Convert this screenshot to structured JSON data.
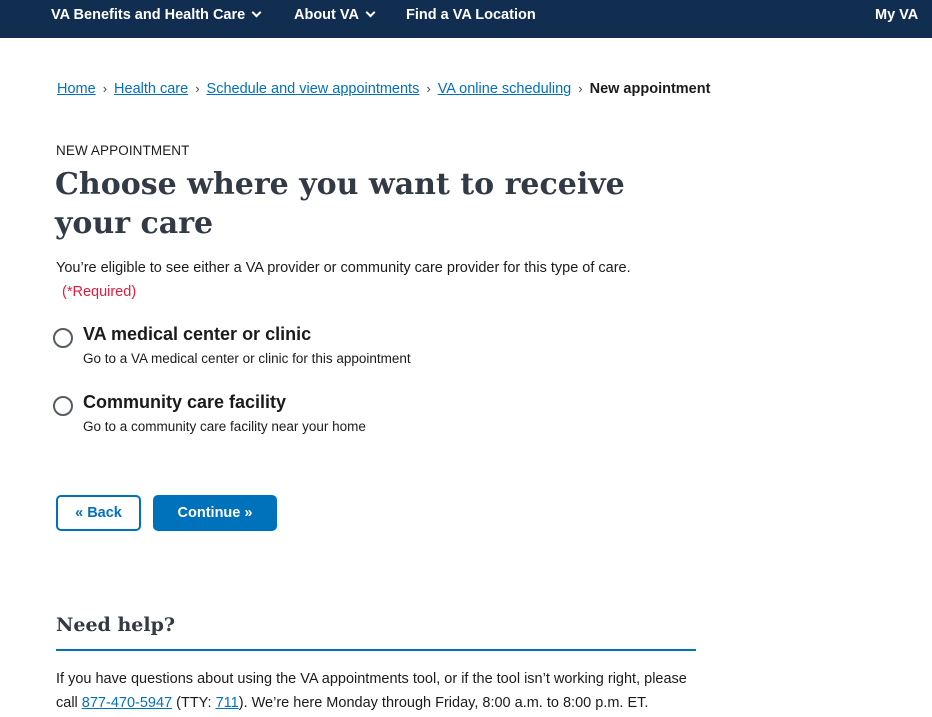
{
  "topnav": {
    "items": [
      {
        "label": "VA Benefits and Health Care",
        "has_dropdown": true
      },
      {
        "label": "About VA",
        "has_dropdown": true
      },
      {
        "label": "Find a VA Location",
        "has_dropdown": false
      }
    ],
    "my_va": "My VA",
    "bg_color": "#112e51"
  },
  "breadcrumb": {
    "items": [
      "Home",
      "Health care",
      "Schedule and view appointments",
      "VA online scheduling"
    ],
    "separator": "›",
    "current": "New appointment"
  },
  "page": {
    "eyebrow": "NEW APPOINTMENT",
    "title": "Choose where you want to receive your care",
    "intro": "You’re eligible to see either a VA provider or community care provider for this type of care.",
    "required": "(*Required)"
  },
  "options": [
    {
      "label": "VA medical center or clinic",
      "description": "Go to a VA medical center or clinic for this appointment",
      "selected": false
    },
    {
      "label": "Community care facility",
      "description": "Go to a community care facility near your home",
      "selected": false
    }
  ],
  "buttons": {
    "back": "« Back",
    "continue": "Continue »"
  },
  "help": {
    "title": "Need help?",
    "text_1": "If you have questions about using the VA appointments tool, or if the tool isn’t working right, please call ",
    "phone": "877-470-5947",
    "text_2": " (TTY: ",
    "tty": "711",
    "text_3": "). We’re here Monday through Friday, 8:00 a.m. to 8:00 p.m. ET."
  },
  "colors": {
    "link": "#0071bb",
    "required": "#e31c3d",
    "heading": "#323a45"
  }
}
